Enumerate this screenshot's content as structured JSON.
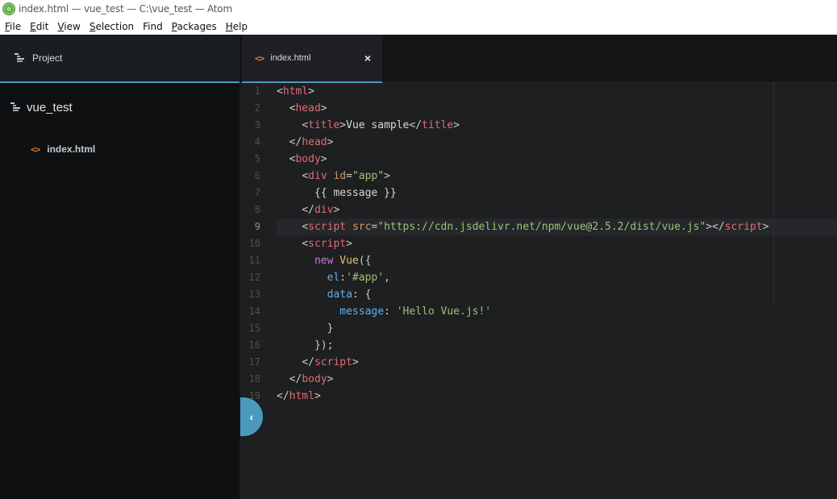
{
  "window": {
    "title": "index.html — vue_test — C:\\vue_test — Atom"
  },
  "menu": [
    {
      "key": "F",
      "rest": "ile"
    },
    {
      "key": "E",
      "rest": "dit"
    },
    {
      "key": "V",
      "rest": "iew"
    },
    {
      "key": "S",
      "rest": "election"
    },
    {
      "key": "F",
      "rest": "ind",
      "suffix": ""
    },
    {
      "key": "P",
      "rest": "ackages"
    },
    {
      "key": "H",
      "rest": "elp"
    }
  ],
  "project_panel": {
    "title": "Project",
    "root": "vue_test",
    "file": "index.html"
  },
  "tab": {
    "label": "index.html",
    "close": "×"
  },
  "editor": {
    "line_numbers": [
      "1",
      "2",
      "3",
      "4",
      "5",
      "6",
      "7",
      "8",
      "9",
      "10",
      "11",
      "12",
      "13",
      "14",
      "15",
      "16",
      "17",
      "18",
      "19"
    ],
    "cursor_line": 9
  },
  "colors": {
    "accent": "#4a9ac0",
    "tag": "#e06c75",
    "attr": "#d19a66",
    "string": "#98c379",
    "icon_orange": "#e37933"
  }
}
